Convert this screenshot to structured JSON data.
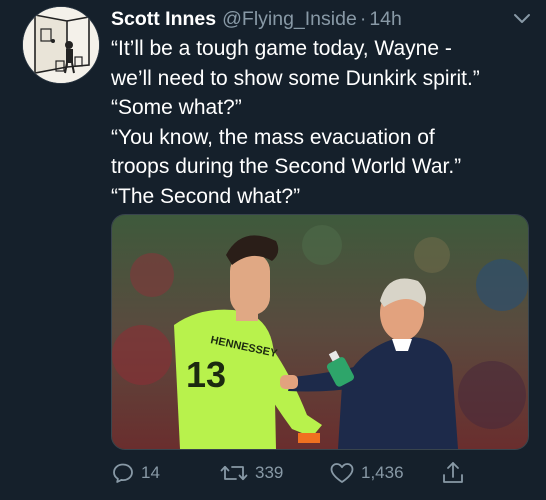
{
  "tweet": {
    "author": {
      "display_name": "Scott Innes",
      "handle": "@Flying_Inside",
      "separator": "·",
      "time": "14h",
      "avatar_icon": "illustrated-figure-avatar"
    },
    "menu_icon": "chevron-down-icon",
    "text_lines": [
      "“It’ll be a tough game today, Wayne -",
      "we’ll need to show some Dunkirk spirit.”",
      "“Some what?”",
      "“You know, the mass evacuation of",
      "troops during the Second World War.”",
      "“The Second what?”"
    ],
    "media": {
      "shirt_text": "HENNESSEY",
      "shirt_number": "13"
    },
    "actions": {
      "reply": {
        "icon": "reply-icon",
        "count": "14"
      },
      "retweet": {
        "icon": "retweet-icon",
        "count": "339"
      },
      "like": {
        "icon": "heart-icon",
        "count": "1,436"
      },
      "share": {
        "icon": "share-icon"
      }
    }
  },
  "colors": {
    "background": "#15202b",
    "text": "#ffffff",
    "secondary_text": "#8899a6",
    "border": "#38444d"
  }
}
